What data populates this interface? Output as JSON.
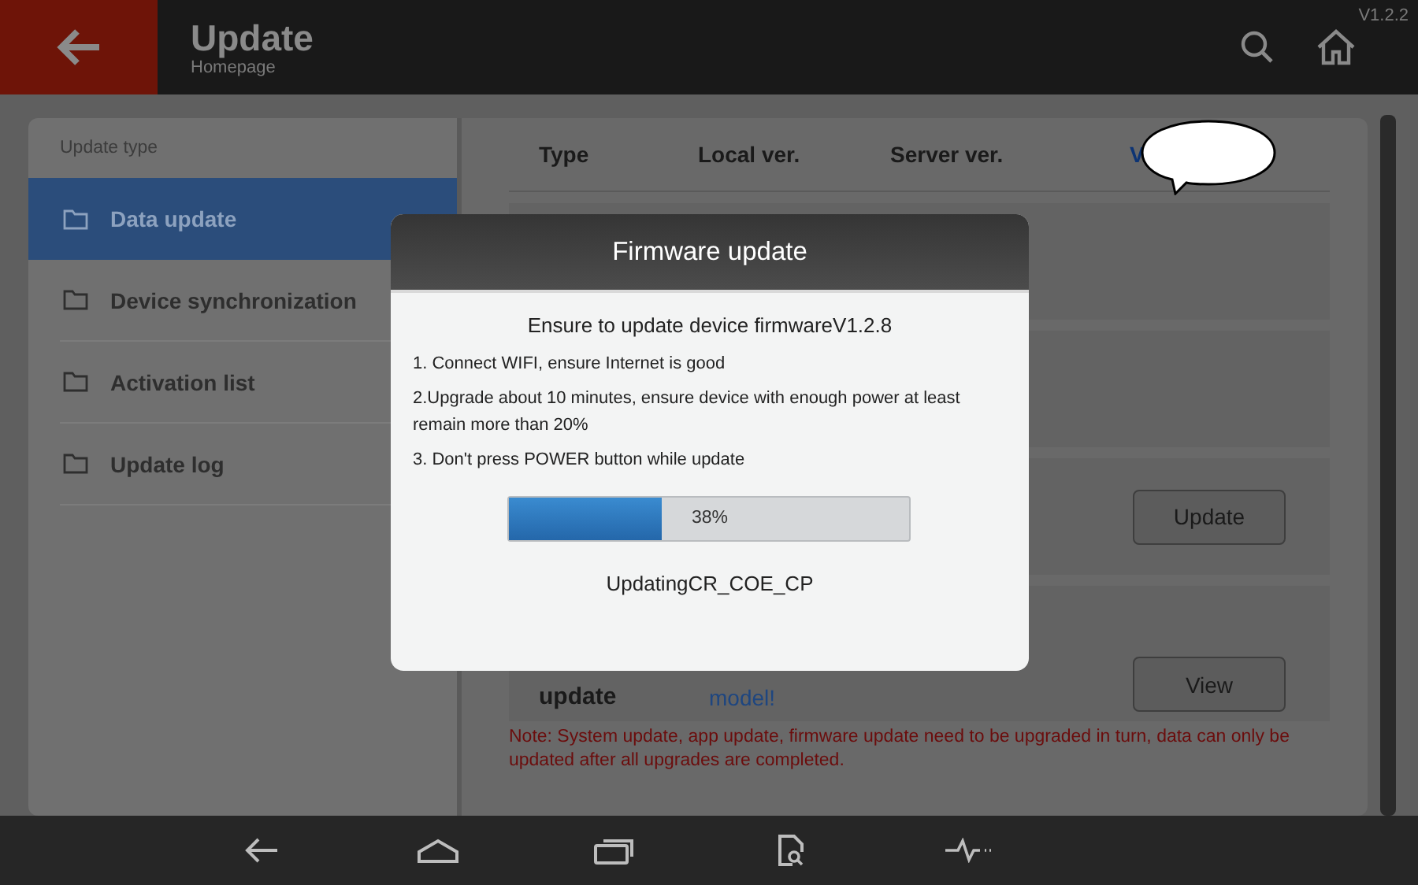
{
  "app_bar": {
    "title": "Update",
    "subtitle": "Homepage",
    "version": "V1.2.2"
  },
  "sidebar": {
    "heading": "Update type",
    "items": [
      {
        "label": "Data update",
        "selected": true
      },
      {
        "label": "Device synchronization",
        "selected": false
      },
      {
        "label": "Activation list",
        "selected": false
      },
      {
        "label": "Update log",
        "selected": false
      }
    ]
  },
  "table": {
    "columns": [
      "Type",
      "Local ver.",
      "Server ver.",
      "V"
    ],
    "rows": [
      {
        "kind": "blank"
      },
      {
        "kind": "blank"
      },
      {
        "kind": "action",
        "button": "Update"
      },
      {
        "kind": "detail",
        "label": "update",
        "description": "model!",
        "button": "View"
      }
    ]
  },
  "note": "Note: System update, app update, firmware update need to be upgraded in turn, data can only be updated after all upgrades are completed.",
  "dialog": {
    "title": "Firmware update",
    "heading": "Ensure to update device firmwareV1.2.8",
    "steps": [
      "1. Connect WIFI, ensure Internet is good",
      "2.Upgrade about 10 minutes, ensure device with enough power at least remain more than 20%",
      "3. Don't press POWER button while update"
    ],
    "progress": {
      "level": 0.38,
      "reading": "38%"
    },
    "status": "UpdatingCR_COE_CP"
  }
}
